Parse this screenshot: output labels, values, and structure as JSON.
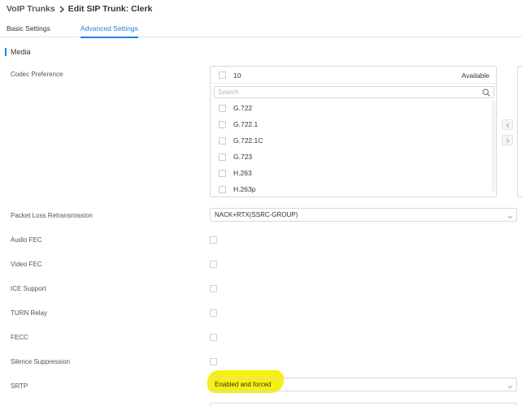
{
  "breadcrumb": {
    "root": "VoIP Trunks",
    "current": "Edit SIP Trunk: Clerk"
  },
  "tabs": [
    {
      "label": "Basic Settings",
      "active": false
    },
    {
      "label": "Advanced Settings",
      "active": true
    }
  ],
  "colors": {
    "accent": "#1f7fdc",
    "highlight": "#f6f000"
  },
  "section": {
    "title": "Media"
  },
  "codec": {
    "label": "Codec Preference",
    "count": "10",
    "available_label": "Available",
    "search_placeholder": "Search",
    "items": [
      "G.722",
      "G.722.1",
      "G.722.1C",
      "G.723",
      "H.263",
      "H.263p"
    ]
  },
  "packet_loss": {
    "label": "Packet Loss Retransmission",
    "value": "NACK+RTX(SSRC-GROUP)"
  },
  "checkbox_fields": [
    {
      "label": "Audio FEC",
      "checked": false
    },
    {
      "label": "Video FEC",
      "checked": false
    },
    {
      "label": "ICE Support",
      "checked": false
    },
    {
      "label": "TURN Relay",
      "checked": false
    },
    {
      "label": "FECC",
      "checked": false
    },
    {
      "label": "Silence Suppression",
      "checked": false
    }
  ],
  "srtp": {
    "label": "SRTP",
    "value": "Enabled and forced"
  }
}
